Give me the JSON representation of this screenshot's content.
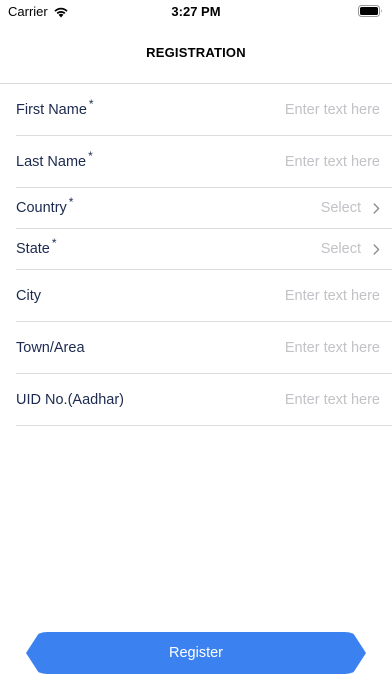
{
  "status_bar": {
    "carrier": "Carrier",
    "time": "3:27 PM"
  },
  "nav": {
    "title": "REGISTRATION"
  },
  "form": {
    "first_name": {
      "label": "First Name",
      "required": "*",
      "placeholder": "Enter text here"
    },
    "last_name": {
      "label": "Last Name",
      "required": "*",
      "placeholder": "Enter text here"
    },
    "country": {
      "label": "Country",
      "required": "*",
      "value": "Select"
    },
    "state": {
      "label": "State",
      "required": "*",
      "value": "Select"
    },
    "city": {
      "label": "City",
      "placeholder": "Enter text here"
    },
    "town": {
      "label": "Town/Area",
      "placeholder": "Enter text here"
    },
    "uid": {
      "label": "UID No.(Aadhar)",
      "placeholder": "Enter text here"
    }
  },
  "register_button": {
    "label": "Register"
  },
  "colors": {
    "accent": "#3b82f0",
    "label": "#1b2a4e",
    "placeholder": "#c2c2c7",
    "divider": "#dcdcdc"
  }
}
